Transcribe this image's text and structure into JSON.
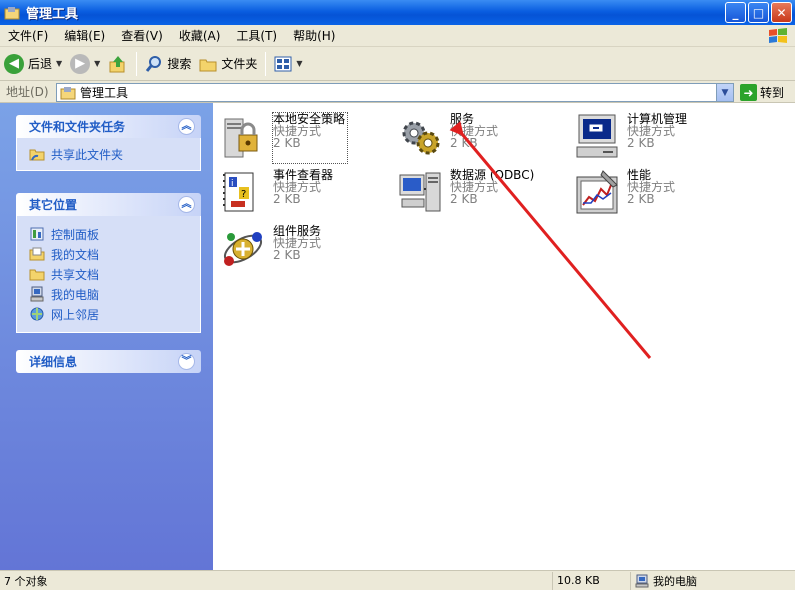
{
  "window": {
    "title": "管理工具",
    "buttons": [
      "_",
      "□",
      "✕"
    ]
  },
  "menu": {
    "items": [
      "文件(F)",
      "编辑(E)",
      "查看(V)",
      "收藏(A)",
      "工具(T)",
      "帮助(H)"
    ]
  },
  "toolbar": {
    "back": "后退",
    "search": "搜索",
    "folders": "文件夹"
  },
  "address": {
    "label": "地址(D)",
    "value": "管理工具",
    "go": "转到"
  },
  "sidebar": {
    "panels": [
      {
        "title": "文件和文件夹任务",
        "items": [
          "共享此文件夹"
        ]
      },
      {
        "title": "其它位置",
        "items": [
          "控制面板",
          "我的文档",
          "共享文档",
          "我的电脑",
          "网上邻居"
        ]
      },
      {
        "title": "详细信息",
        "items": []
      }
    ]
  },
  "files": [
    {
      "name": "本地安全策略",
      "type": "快捷方式",
      "size": "2 KB",
      "icon": "security-policy-icon"
    },
    {
      "name": "服务",
      "type": "快捷方式",
      "size": "2 KB",
      "icon": "services-gear-icon"
    },
    {
      "name": "计算机管理",
      "type": "快捷方式",
      "size": "2 KB",
      "icon": "computer-management-icon"
    },
    {
      "name": "事件查看器",
      "type": "快捷方式",
      "size": "2 KB",
      "icon": "event-viewer-icon"
    },
    {
      "name": "数据源 (ODBC)",
      "type": "快捷方式",
      "size": "2 KB",
      "icon": "odbc-data-source-icon"
    },
    {
      "name": "性能",
      "type": "快捷方式",
      "size": "2 KB",
      "icon": "performance-icon"
    },
    {
      "name": "组件服务",
      "type": "快捷方式",
      "size": "2 KB",
      "icon": "component-services-icon"
    }
  ],
  "status": {
    "count": "7 个对象",
    "size": "10.8 KB",
    "location": "我的电脑"
  },
  "colors": {
    "titlebar": "#0a5ee0",
    "sidebar_link": "#215dc6",
    "annotation_arrow": "#e02020"
  }
}
